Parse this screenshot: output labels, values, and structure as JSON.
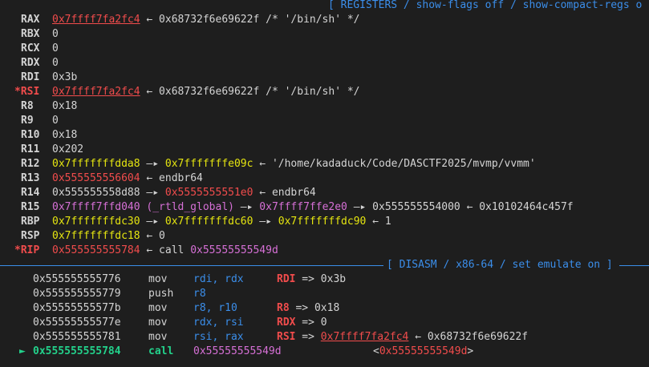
{
  "registers_header": {
    "title": "[ REGISTERS / show-flags off / show-compact-regs o"
  },
  "registers": [
    {
      "name": "RAX",
      "changed": false,
      "parts": [
        {
          "text": "0x7ffff7fa2fc4",
          "style": "red ul"
        },
        {
          "text": " ← 0x68732f6e69622f /* '/bin/sh' */",
          "style": "white"
        }
      ]
    },
    {
      "name": "RBX",
      "changed": false,
      "parts": [
        {
          "text": "0",
          "style": "white"
        }
      ]
    },
    {
      "name": "RCX",
      "changed": false,
      "parts": [
        {
          "text": "0",
          "style": "white"
        }
      ]
    },
    {
      "name": "RDX",
      "changed": false,
      "parts": [
        {
          "text": "0",
          "style": "white"
        }
      ]
    },
    {
      "name": "RDI",
      "changed": false,
      "parts": [
        {
          "text": "0x3b",
          "style": "white"
        }
      ]
    },
    {
      "name": "*RSI",
      "changed": true,
      "parts": [
        {
          "text": "0x7ffff7fa2fc4",
          "style": "red ul"
        },
        {
          "text": " ← 0x68732f6e69622f /* '/bin/sh' */",
          "style": "white"
        }
      ]
    },
    {
      "name": "R8",
      "changed": false,
      "parts": [
        {
          "text": "0x18",
          "style": "white"
        }
      ]
    },
    {
      "name": "R9",
      "changed": false,
      "parts": [
        {
          "text": "0",
          "style": "white"
        }
      ]
    },
    {
      "name": "R10",
      "changed": false,
      "parts": [
        {
          "text": "0x18",
          "style": "white"
        }
      ]
    },
    {
      "name": "R11",
      "changed": false,
      "parts": [
        {
          "text": "0x202",
          "style": "white"
        }
      ]
    },
    {
      "name": "R12",
      "changed": false,
      "parts": [
        {
          "text": "0x7fffffffdda8",
          "style": "yellow"
        },
        {
          "text": " —▸ ",
          "style": "white"
        },
        {
          "text": "0x7fffffffe09c",
          "style": "yellow"
        },
        {
          "text": " ← '/home/kadaduck/Code/DASCTF2025/mvmp/vvmm'",
          "style": "white"
        }
      ]
    },
    {
      "name": "R13",
      "changed": false,
      "parts": [
        {
          "text": "0x555555556604",
          "style": "red"
        },
        {
          "text": " ← endbr64",
          "style": "white"
        }
      ]
    },
    {
      "name": "R14",
      "changed": false,
      "parts": [
        {
          "text": "0x555555558d88",
          "style": "white"
        },
        {
          "text": " —▸ ",
          "style": "white"
        },
        {
          "text": "0x5555555551e0",
          "style": "red"
        },
        {
          "text": " ← endbr64",
          "style": "white"
        }
      ]
    },
    {
      "name": "R15",
      "changed": false,
      "parts": [
        {
          "text": "0x7ffff7ffd040 (_rtld_global)",
          "style": "magenta"
        },
        {
          "text": " —▸ ",
          "style": "white"
        },
        {
          "text": "0x7ffff7ffe2e0",
          "style": "magenta"
        },
        {
          "text": " —▸ 0x555555554000 ← 0x10102464c457f",
          "style": "white"
        }
      ]
    },
    {
      "name": "RBP",
      "changed": false,
      "parts": [
        {
          "text": "0x7fffffffdc30",
          "style": "yellow"
        },
        {
          "text": " —▸ ",
          "style": "white"
        },
        {
          "text": "0x7fffffffdc60",
          "style": "yellow"
        },
        {
          "text": " —▸ ",
          "style": "white"
        },
        {
          "text": "0x7fffffffdc90",
          "style": "yellow"
        },
        {
          "text": " ← 1",
          "style": "white"
        }
      ]
    },
    {
      "name": "RSP",
      "changed": false,
      "parts": [
        {
          "text": "0x7fffffffdc18",
          "style": "yellow"
        },
        {
          "text": " ← 0",
          "style": "white"
        }
      ]
    },
    {
      "name": "*RIP",
      "changed": true,
      "parts": [
        {
          "text": "0x555555555784",
          "style": "red"
        },
        {
          "text": " ← call ",
          "style": "white"
        },
        {
          "text": "0x55555555549d",
          "style": "magenta"
        }
      ]
    }
  ],
  "disasm_header": {
    "title": "[ DISASM / x86-64 / set emulate on ]"
  },
  "disasm": [
    {
      "addr": "0x555555555776",
      "mnem": "mov",
      "ops": "rdi, rdx",
      "current": false,
      "ann": [
        {
          "text": "RDI",
          "style": "red bold"
        },
        {
          "text": " => 0x3b",
          "style": "white"
        }
      ]
    },
    {
      "addr": "0x555555555779",
      "mnem": "push",
      "ops": "r8",
      "current": false,
      "ann": []
    },
    {
      "addr": "0x55555555577b",
      "mnem": "mov",
      "ops": "r8, r10",
      "current": false,
      "ann": [
        {
          "text": "R8",
          "style": "red bold"
        },
        {
          "text": " => 0x18",
          "style": "white"
        }
      ]
    },
    {
      "addr": "0x55555555577e",
      "mnem": "mov",
      "ops": "rdx, rsi",
      "current": false,
      "ann": [
        {
          "text": "RDX",
          "style": "red bold"
        },
        {
          "text": " => 0",
          "style": "white"
        }
      ]
    },
    {
      "addr": "0x555555555781",
      "mnem": "mov",
      "ops": "rsi, rax",
      "current": false,
      "ann": [
        {
          "text": "RSI",
          "style": "red bold"
        },
        {
          "text": " => ",
          "style": "white"
        },
        {
          "text": "0x7ffff7fa2fc4",
          "style": "red ul"
        },
        {
          "text": " ← 0x68732f6e69622f",
          "style": "white"
        }
      ]
    },
    {
      "addr": "0x555555555784",
      "mnem": "call",
      "ops": "0x55555555549d",
      "current": true,
      "pointer": "►",
      "ann2": [
        {
          "text": "<",
          "style": "white"
        },
        {
          "text": "0x55555555549d",
          "style": "red"
        },
        {
          "text": ">",
          "style": "white"
        }
      ]
    }
  ],
  "colors": {
    "background": "#1e1e1e",
    "red": "#f14c4c",
    "yellow": "#e5e510",
    "magenta": "#d670d6",
    "blue": "#3b8eea",
    "green": "#23d18b"
  }
}
